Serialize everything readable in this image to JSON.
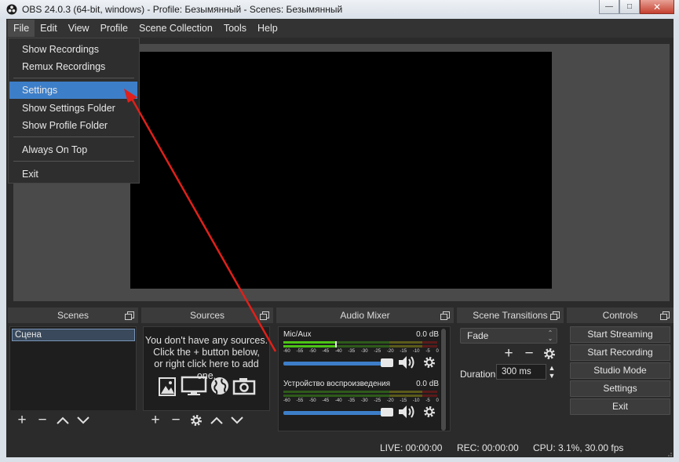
{
  "window": {
    "title": "OBS 24.0.3 (64-bit, windows) - Profile: Безымянный - Scenes: Безымянный",
    "buttons": {
      "minimize": "—",
      "maximize": "□",
      "close": "✕"
    }
  },
  "menubar": {
    "file": "File",
    "edit": "Edit",
    "view": "View",
    "profile": "Profile",
    "scene_collection": "Scene Collection",
    "tools": "Tools",
    "help": "Help"
  },
  "file_menu": {
    "show_recordings": "Show Recordings",
    "remux_recordings": "Remux Recordings",
    "settings": "Settings",
    "show_settings_folder": "Show Settings Folder",
    "show_profile_folder": "Show Profile Folder",
    "always_on_top": "Always On Top",
    "exit": "Exit",
    "selected": "Settings"
  },
  "scenes": {
    "title": "Scenes",
    "items": [
      "Сцена"
    ]
  },
  "sources": {
    "title": "Sources",
    "empty_line1": "You don't have any sources.",
    "empty_line2": "Click the + button below,",
    "empty_line3": "or right click here to add one."
  },
  "audio_mixer": {
    "title": "Audio Mixer",
    "channels": [
      {
        "name": "Mic/Aux",
        "db": "0.0 dB",
        "level": 0.34,
        "volume": 1.0
      },
      {
        "name": "Устройство воспроизведения",
        "db": "0.0 dB",
        "level": 0.0,
        "volume": 1.0
      }
    ],
    "scale": [
      "-60",
      "-55",
      "-50",
      "-45",
      "-40",
      "-35",
      "-30",
      "-25",
      "-20",
      "-15",
      "-10",
      "-5",
      "0"
    ]
  },
  "scene_transitions": {
    "title": "Scene Transitions",
    "selected": "Fade",
    "duration_label": "Duration",
    "duration_value": "300 ms"
  },
  "controls": {
    "title": "Controls",
    "start_streaming": "Start Streaming",
    "start_recording": "Start Recording",
    "studio_mode": "Studio Mode",
    "settings": "Settings",
    "exit": "Exit"
  },
  "status": {
    "live": "LIVE: 00:00:00",
    "rec": "REC: 00:00:00",
    "cpu": "CPU: 3.1%, 30.00 fps"
  },
  "colors": {
    "accent": "#3d7ec8",
    "annotation_arrow": "#e0201a",
    "meter_green": "#4cc417",
    "meter_yellow": "#c8c81e",
    "meter_red": "#d13030"
  }
}
